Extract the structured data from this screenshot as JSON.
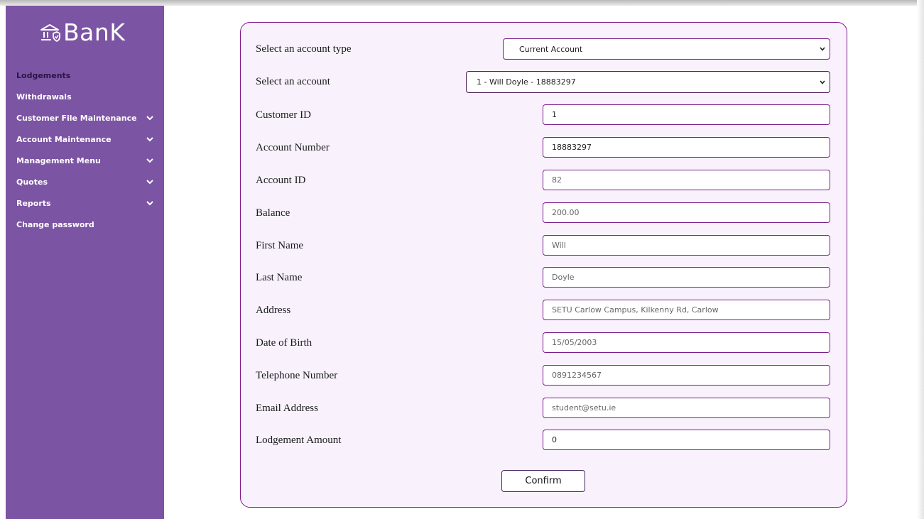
{
  "brand": {
    "name": "BanK"
  },
  "sidebar": {
    "items": [
      {
        "label": "Lodgements",
        "dropdown": false,
        "active": true
      },
      {
        "label": "Withdrawals",
        "dropdown": false
      },
      {
        "label": "Customer File Maintenance",
        "dropdown": true
      },
      {
        "label": "Account Maintenance",
        "dropdown": true
      },
      {
        "label": "Management Menu",
        "dropdown": true
      },
      {
        "label": "Quotes",
        "dropdown": true
      },
      {
        "label": "Reports",
        "dropdown": true
      },
      {
        "label": "Change password",
        "dropdown": false
      }
    ]
  },
  "form": {
    "account_type": {
      "label": "Select an account type",
      "value": "Current Account"
    },
    "account": {
      "label": "Select an account",
      "value": "1 - Will Doyle - 18883297"
    },
    "fields": [
      {
        "label": "Customer ID",
        "value": "1",
        "readonly": false
      },
      {
        "label": "Account Number",
        "value": "18883297",
        "readonly": false
      },
      {
        "label": "Account ID",
        "value": "82",
        "readonly": true
      },
      {
        "label": "Balance",
        "value": "200.00",
        "readonly": true
      },
      {
        "label": "First Name",
        "value": "Will",
        "readonly": true
      },
      {
        "label": "Last Name",
        "value": "Doyle",
        "readonly": true
      },
      {
        "label": "Address",
        "value": "SETU Carlow Campus, Kilkenny Rd, Carlow",
        "readonly": true
      },
      {
        "label": "Date of Birth",
        "value": "15/05/2003",
        "readonly": true
      },
      {
        "label": "Telephone Number",
        "value": "0891234567",
        "readonly": true
      },
      {
        "label": "Email Address",
        "value": "student@setu.ie",
        "readonly": true
      },
      {
        "label": "Lodgement Amount",
        "value": "0",
        "readonly": false
      }
    ],
    "confirm_label": "Confirm"
  },
  "colors": {
    "sidebar": "#7b54a3",
    "accent": "#80198c",
    "card_bg": "#f9f2fd"
  }
}
